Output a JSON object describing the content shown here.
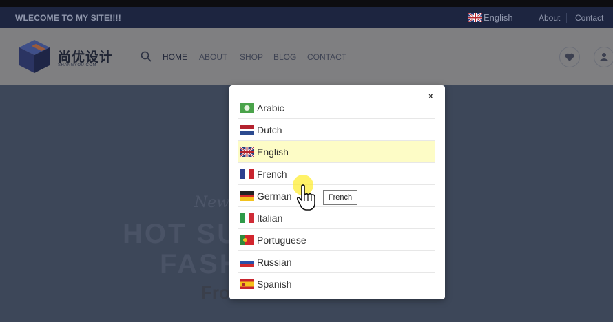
{
  "topbar": {
    "welcome": "WLECOME TO MY SITE!!!!",
    "language": "English",
    "about": "About",
    "contact": "Contact"
  },
  "header": {
    "logo_text": "尚优设计",
    "logo_sub": "SHANGYOU.COM",
    "nav": [
      "HOME",
      "ABOUT",
      "SHOP",
      "BLOG",
      "CONTACT"
    ]
  },
  "hero": {
    "script": "New",
    "line1": "HOT SU",
    "line2": "FASH",
    "line3": "Fro"
  },
  "modal": {
    "close": "x",
    "selected": "English",
    "languages": [
      "Arabic",
      "Dutch",
      "English",
      "French",
      "German",
      "Italian",
      "Portuguese",
      "Russian",
      "Spanish"
    ]
  },
  "tooltip": "French",
  "colors": {
    "topbar_bg": "#1d2540",
    "header_bg": "#7f7f81",
    "hero_bg": "#3d4759",
    "selected_row": "#fdfcc6",
    "cursor_highlight": "#ffec28"
  }
}
